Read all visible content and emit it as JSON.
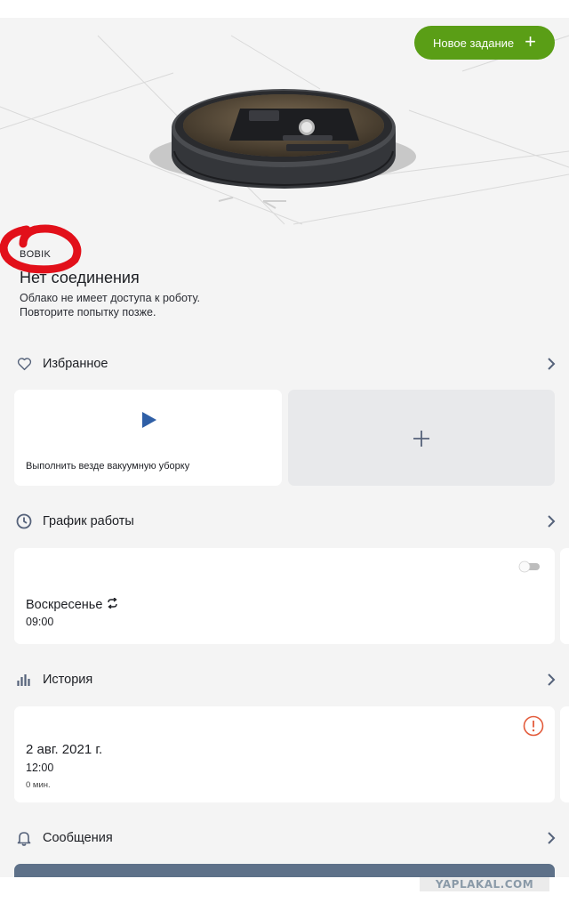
{
  "header": {
    "new_task_label": "Новое задание",
    "new_task_icon": "plus-icon"
  },
  "robot": {
    "name": "BOBIK",
    "status_title": "Нет соединения",
    "status_line1": "Облако не имеет доступа к роботу.",
    "status_line2": "Повторите попытку позже."
  },
  "favorites": {
    "title": "Избранное",
    "icon": "heart-icon",
    "items": [
      {
        "label": "Выполнить везде вакуумную уборку",
        "icon": "play-icon"
      }
    ],
    "add_icon": "plus-icon"
  },
  "schedule": {
    "title": "График работы",
    "icon": "clock-icon",
    "items": [
      {
        "day": "Воскресенье",
        "time": "09:00",
        "enabled": false,
        "repeat_icon": "repeat-icon"
      }
    ]
  },
  "history": {
    "title": "История",
    "icon": "bar-chart-icon",
    "items": [
      {
        "date": "2 авг. 2021 г.",
        "time": "12:00",
        "duration": "0 мин.",
        "status_icon": "warning-icon"
      }
    ]
  },
  "messages": {
    "title": "Сообщения",
    "icon": "bell-icon"
  },
  "watermark": "YAPLAKAL.COM",
  "colors": {
    "accent_green": "#5a9e16",
    "play_blue": "#2f5fa6",
    "warning_red": "#e35b3b",
    "scribble_red": "#e2101a",
    "message_card": "#5e7189",
    "background": "#f4f4f4"
  }
}
